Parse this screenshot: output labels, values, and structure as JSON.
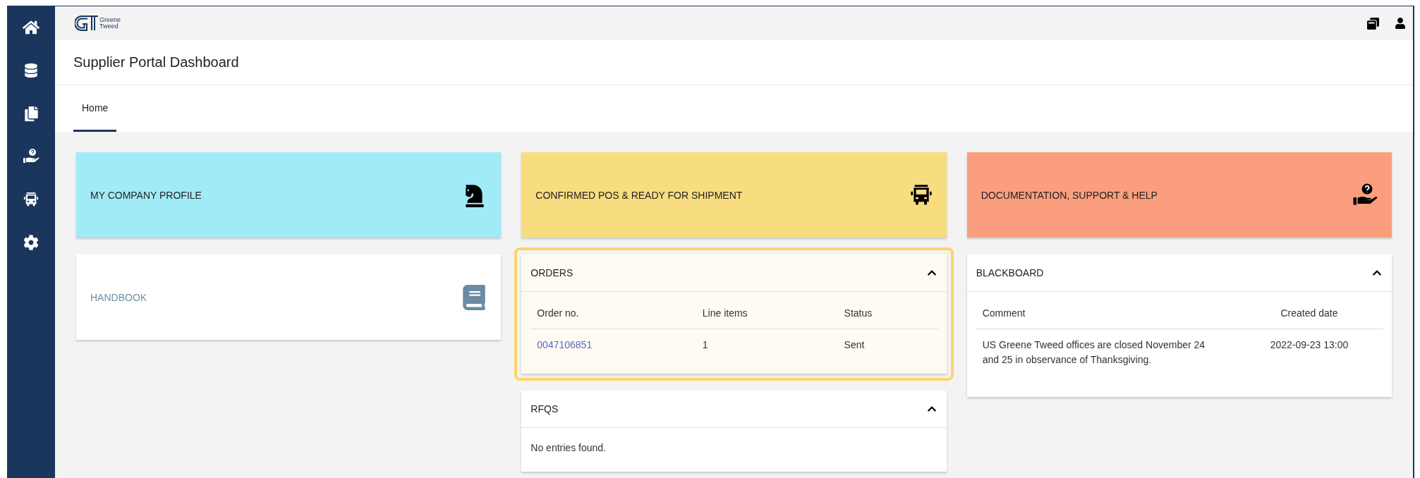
{
  "sidebar": {
    "items": [
      {
        "kind": "home"
      },
      {
        "kind": "database"
      },
      {
        "kind": "documents"
      },
      {
        "kind": "support"
      },
      {
        "kind": "truck"
      },
      {
        "kind": "settings"
      }
    ]
  },
  "header": {
    "logo": {
      "line_1": "Greene",
      "line_2": "Tweed"
    }
  },
  "title": "Supplier Portal Dashboard",
  "tabs": [
    {
      "label": "Home",
      "selected": true
    }
  ],
  "tiles": [
    {
      "label": "MY COMPANY PROFILE",
      "kind": "knight",
      "color": "#a0ebf7"
    },
    {
      "label": "CONFIRMED POS & READY FOR SHIPMENT",
      "kind": "truck",
      "color": "#f8dc80"
    },
    {
      "label": "DOCUMENTATION, SUPPORT & HELP",
      "kind": "support",
      "color": "#fa9e7e"
    },
    {
      "label": "HANDBOOK",
      "kind": "book",
      "color": "#ffffff"
    }
  ],
  "orders": {
    "title": "ORDERS",
    "expanded": true,
    "highlighted": true,
    "columns": [
      "Order no.",
      "Line items",
      "Status"
    ],
    "rows": [
      {
        "cells": [
          "0047106851",
          "1",
          "Sent"
        ]
      }
    ]
  },
  "rfqs": {
    "title": "RFQS",
    "expanded": true,
    "empty_text": "No entries found."
  },
  "blackboard": {
    "title": "BLACKBOARD",
    "expanded": true,
    "columns": [
      "Comment",
      "Created date"
    ],
    "rows": [
      {
        "cells": [
          "US Greene Tweed offices are closed November 24 and 25 in observance of Thanksgiving.",
          "2022-09-23 13:00"
        ]
      }
    ]
  }
}
